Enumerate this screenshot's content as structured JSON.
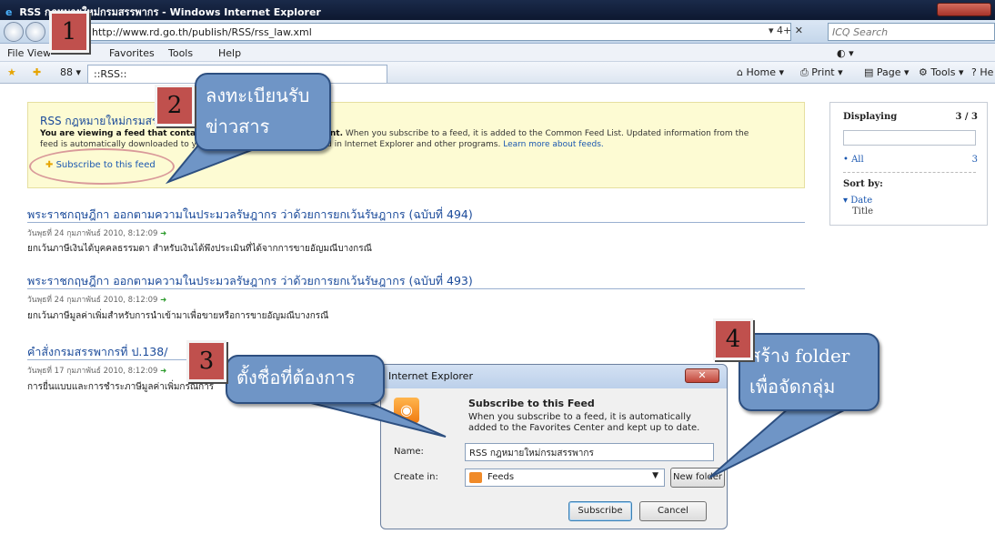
{
  "window": {
    "title": "RSS กฎหมายใหม่กรมสรรพากร - Windows Internet Explorer",
    "ie_logo": "e",
    "caption_buttons": [
      "minimize",
      "maximize",
      "close"
    ]
  },
  "address_bar": {
    "url": "http://www.rd.go.th/publish/RSS/rss_law.xml",
    "tools": "▾ 4+ ✕",
    "search_placeholder": "ICQ Search"
  },
  "menu": [
    "File",
    "View",
    "Favorites",
    "Tools",
    "Help"
  ],
  "command_bar": {
    "tab_label": "::RSS::",
    "view_control": "88 ▾",
    "home": "Home",
    "print": "Print",
    "page": "Page",
    "tools": "Tools",
    "help": "He"
  },
  "feed_box": {
    "title": "RSS กฎหมายใหม่กรมสรรพากร",
    "desc_bold": "You are viewing a feed that contains frequently updated content.",
    "desc_rest": "When you subscribe to a feed, it is added to the Common Feed List. Updated information from the feed is automatically downloaded to your computer and can be viewed in Internet Explorer and other programs.",
    "learn_more": "Learn more about feeds.",
    "subscribe_link": "Subscribe to this feed"
  },
  "right_panel": {
    "displaying": "Displaying",
    "count": "3 / 3",
    "filter_all": "• All",
    "filter_all_count": "3",
    "sort_by": "Sort by:",
    "sort_date": "▾ Date",
    "sort_title": "Title"
  },
  "articles": [
    {
      "title": "พระราชกฤษฎีกา ออกตามความในประมวลรัษฎากร ว่าด้วยการยกเว้นรัษฎากร (ฉบับที่ 494)",
      "date": "วันพุธที่ 24 กุมภาพันธ์ 2010, 8:12:09",
      "summary": "ยกเว้นภาษีเงินได้บุคคลธรรมดา สำหรับเงินได้พึงประเมินที่ได้จากการขายอัญมณีบางกรณี"
    },
    {
      "title": "พระราชกฤษฎีกา ออกตามความในประมวลรัษฎากร ว่าด้วยการยกเว้นรัษฎากร (ฉบับที่ 493)",
      "date": "วันพุธที่ 24 กุมภาพันธ์ 2010, 8:12:09",
      "summary": "ยกเว้นภาษีมูลค่าเพิ่มสำหรับการนำเข้ามาเพื่อขายหรือการขายอัญมณีบางกรณี"
    },
    {
      "title": "คำสั่งกรมสรรพากรที่ ป.138/",
      "date": "วันพุธที่ 17 กุมภาพันธ์ 2010, 8:12:09",
      "summary": "การยื่นแบบและการชำระภาษีมูลค่าเพิ่มกรณีการ"
    }
  ],
  "dialog": {
    "title": "Internet Explorer",
    "close": "✕",
    "heading": "Subscribe to this Feed",
    "text": "When you subscribe to a feed, it is automatically added to the Favorites Center and kept up to date.",
    "name_label": "Name:",
    "name_value": "RSS กฎหมายใหม่กรมสรรพากร",
    "create_label": "Create in:",
    "create_value": "Feeds",
    "new_folder": "New folder",
    "subscribe": "Subscribe",
    "cancel": "Cancel"
  },
  "annotations": {
    "n1": "1",
    "n2": "2",
    "n3": "3",
    "n4": "4",
    "callout2_line1": "ลงทะเบียนรับ",
    "callout2_line2": "ข่าวสาร",
    "callout3": "ตั้งชื่อที่ต้องการ",
    "callout4_line1": "สร้าง folder",
    "callout4_line2": "เพื่อจัดกลุ่ม"
  },
  "colors": {
    "annotation_red": "#c0504d",
    "callout_blue": "#6f95c6",
    "link_blue": "#1a4a9a",
    "feed_yellow": "#fdfbd3"
  }
}
